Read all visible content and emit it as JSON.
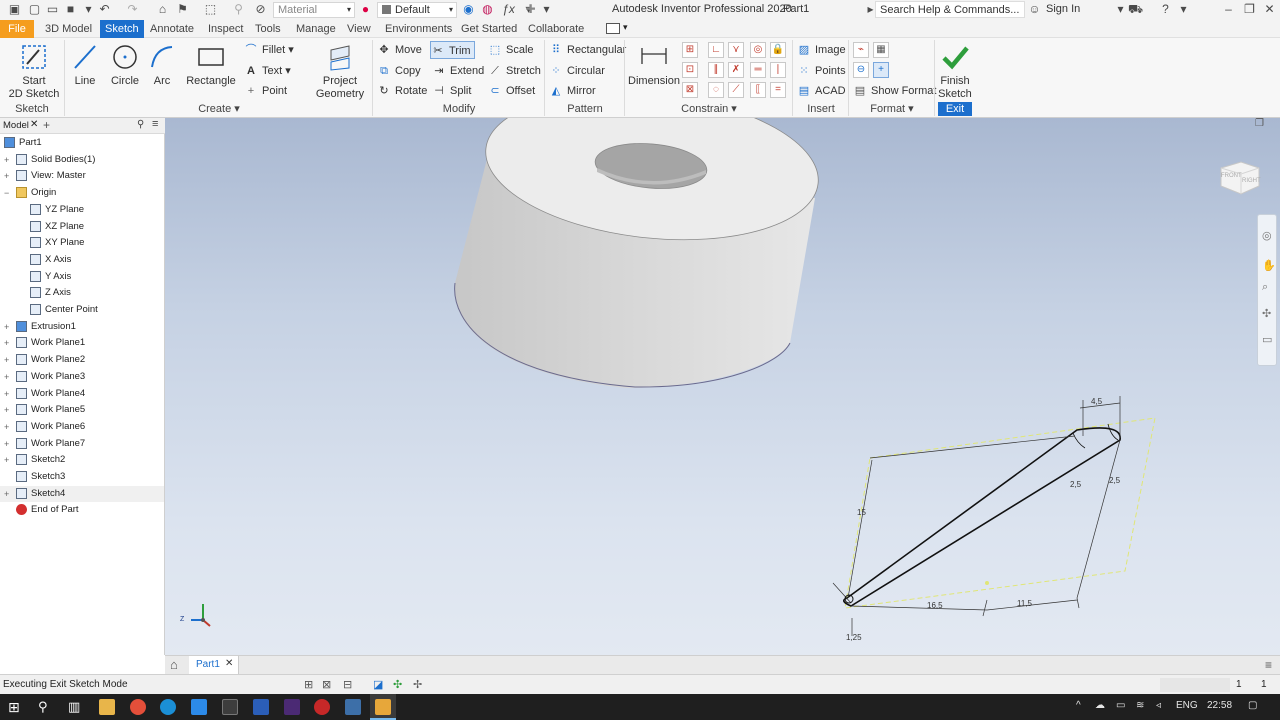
{
  "app": {
    "title": "Autodesk Inventor Professional 2020",
    "document": "Part1",
    "search_placeholder": "Search Help & Commands...",
    "sign_in": "Sign In",
    "material": "Material",
    "appearance": "Default"
  },
  "menu": {
    "file": "File",
    "tabs": [
      "3D Model",
      "Sketch",
      "Annotate",
      "Inspect",
      "Tools",
      "Manage",
      "View",
      "Environments",
      "Get Started",
      "Collaborate"
    ],
    "active": "Sketch"
  },
  "ribbon": {
    "sketch_group": {
      "label": "Sketch",
      "start": "Start",
      "start2": "2D Sketch"
    },
    "create_group": {
      "label": "Create",
      "line": "Line",
      "circle": "Circle",
      "arc": "Arc",
      "rectangle": "Rectangle",
      "fillet": "Fillet",
      "text": "Text",
      "point": "Point"
    },
    "project": {
      "l1": "Project",
      "l2": "Geometry"
    },
    "modify_group": {
      "label": "Modify",
      "move": "Move",
      "trim": "Trim",
      "scale": "Scale",
      "copy": "Copy",
      "extend": "Extend",
      "stretch": "Stretch",
      "rotate": "Rotate",
      "split": "Split",
      "offset": "Offset"
    },
    "pattern_group": {
      "label": "Pattern",
      "rectangular": "Rectangular",
      "circular": "Circular",
      "mirror": "Mirror"
    },
    "constrain_group": {
      "label": "Constrain",
      "dimension": "Dimension"
    },
    "insert_group": {
      "label": "Insert",
      "image": "Image",
      "points": "Points",
      "acad": "ACAD"
    },
    "format_group": {
      "label": "Format",
      "show_format": "Show Format"
    },
    "exit_group": {
      "label": "Exit",
      "finish1": "Finish",
      "finish2": "Sketch"
    }
  },
  "browser": {
    "tab": "Model",
    "items": [
      {
        "label": "Part1",
        "level": 0,
        "pm": ""
      },
      {
        "label": "Solid Bodies(1)",
        "level": 1,
        "pm": "+"
      },
      {
        "label": "View: Master",
        "level": 1,
        "pm": "+"
      },
      {
        "label": "Origin",
        "level": 1,
        "pm": "−"
      },
      {
        "label": "YZ Plane",
        "level": 2,
        "pm": ""
      },
      {
        "label": "XZ Plane",
        "level": 2,
        "pm": ""
      },
      {
        "label": "XY Plane",
        "level": 2,
        "pm": ""
      },
      {
        "label": "X Axis",
        "level": 2,
        "pm": ""
      },
      {
        "label": "Y Axis",
        "level": 2,
        "pm": ""
      },
      {
        "label": "Z Axis",
        "level": 2,
        "pm": ""
      },
      {
        "label": "Center Point",
        "level": 2,
        "pm": ""
      },
      {
        "label": "Extrusion1",
        "level": 1,
        "pm": "+"
      },
      {
        "label": "Work Plane1",
        "level": 1,
        "pm": "+"
      },
      {
        "label": "Work Plane2",
        "level": 1,
        "pm": "+"
      },
      {
        "label": "Work Plane3",
        "level": 1,
        "pm": "+"
      },
      {
        "label": "Work Plane4",
        "level": 1,
        "pm": "+"
      },
      {
        "label": "Work Plane5",
        "level": 1,
        "pm": "+"
      },
      {
        "label": "Work Plane6",
        "level": 1,
        "pm": "+"
      },
      {
        "label": "Work Plane7",
        "level": 1,
        "pm": "+"
      },
      {
        "label": "Sketch2",
        "level": 1,
        "pm": "+"
      },
      {
        "label": "Sketch3",
        "level": 1,
        "pm": ""
      },
      {
        "label": "Sketch4",
        "level": 1,
        "pm": "+"
      },
      {
        "label": "End of Part",
        "level": 1,
        "pm": ""
      }
    ]
  },
  "viewcube": {
    "front": "FRONT",
    "right": "RIGHT"
  },
  "sketch_dims": {
    "d1": "4,5",
    "d2": "2,5",
    "d3": "2,5",
    "d4": "15",
    "d5": "16,5",
    "d6": "11,5",
    "d7": "1,25"
  },
  "triad": {
    "z": "Z"
  },
  "doc_tab": "Part1",
  "status": {
    "message": "Executing Exit Sketch Mode",
    "count1": "1",
    "count2": "1"
  },
  "taskbar": {
    "lang": "ENG",
    "time": "22:58"
  },
  "colors": {
    "accent": "#1c6fcd",
    "file_tab": "#f59d1e",
    "finish_check": "#2e9e3c"
  }
}
